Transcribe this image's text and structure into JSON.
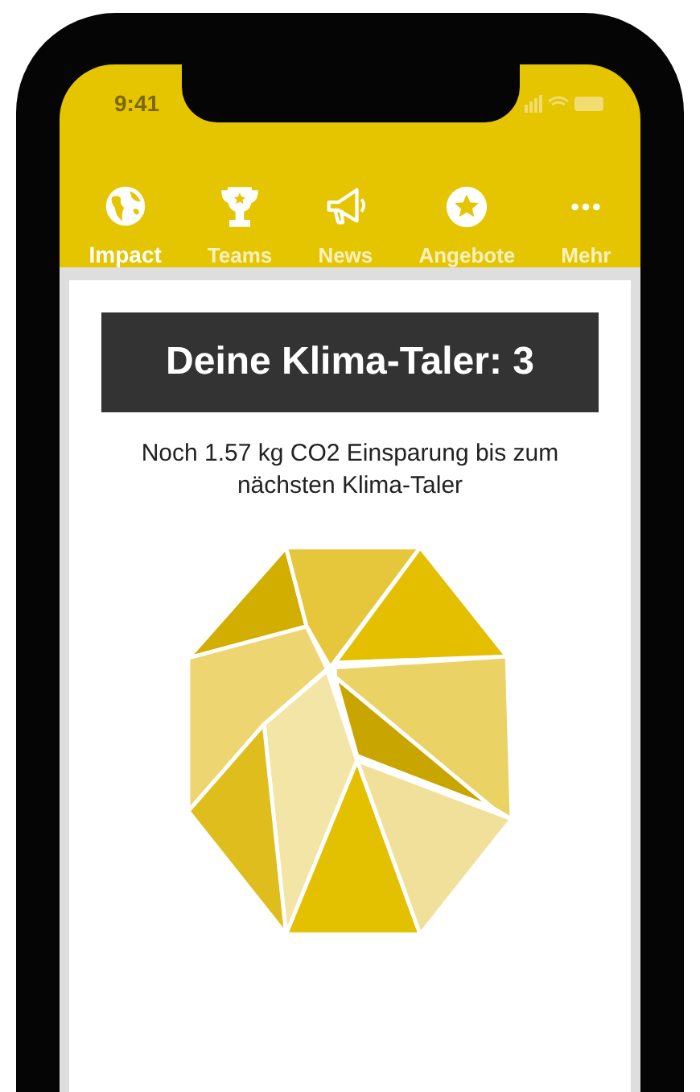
{
  "status_bar": {
    "time": "9:41"
  },
  "nav": [
    {
      "label": "Impact",
      "kind": "globe",
      "selected": true
    },
    {
      "label": "Teams",
      "kind": "trophy",
      "selected": false
    },
    {
      "label": "News",
      "kind": "megaphone",
      "selected": false
    },
    {
      "label": "Angebote",
      "kind": "star",
      "selected": false
    },
    {
      "label": "Mehr",
      "kind": "more",
      "selected": false
    }
  ],
  "card": {
    "title": "Deine Klima-Taler: 3",
    "subtitle": "Noch 1.57 kg CO2 Einsparung bis zum nächsten Klima-Taler"
  }
}
